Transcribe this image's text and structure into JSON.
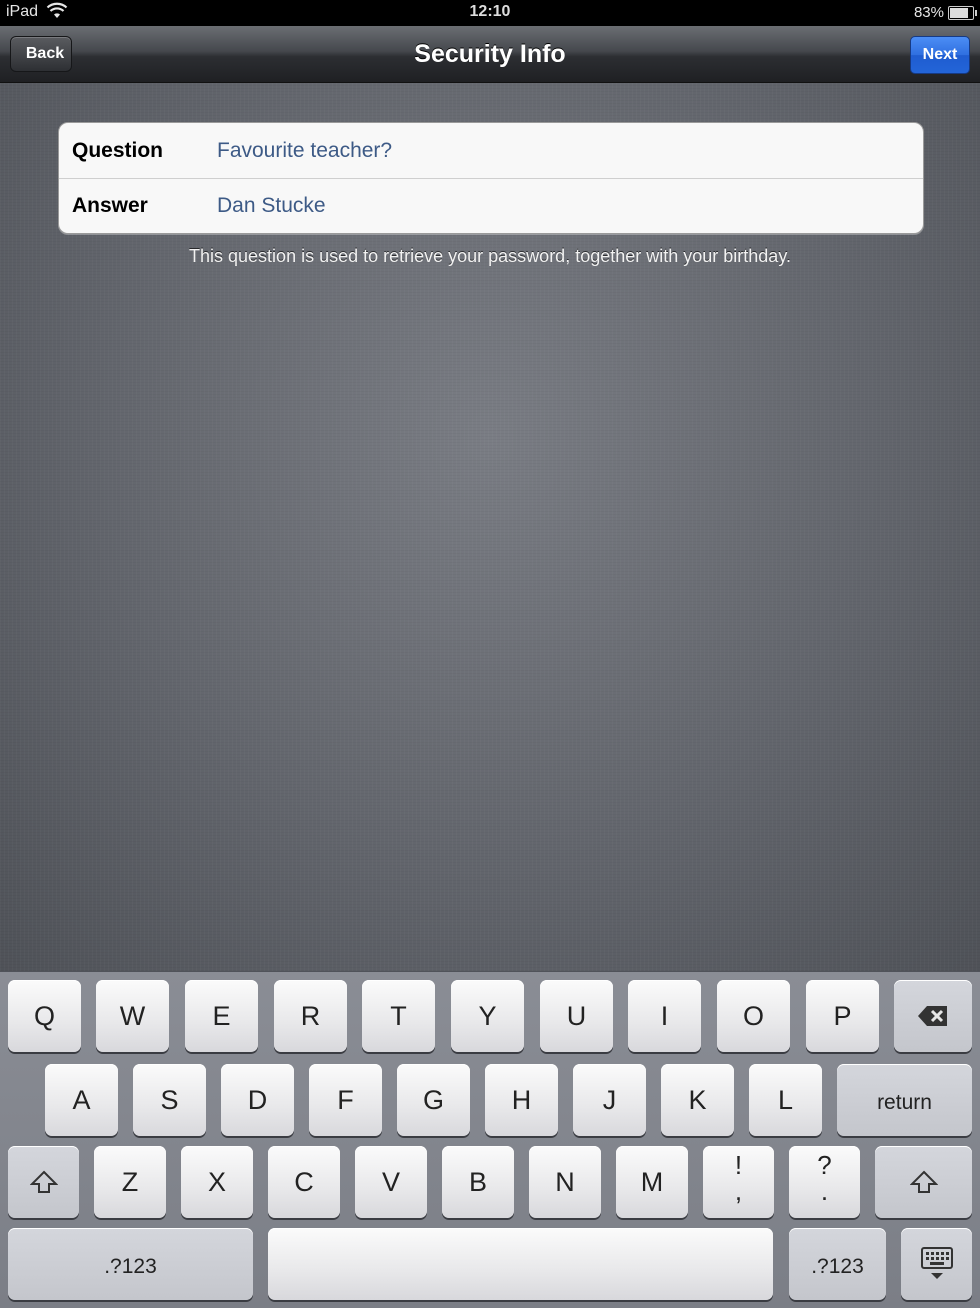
{
  "status_bar": {
    "carrier": "iPad",
    "time": "12:10",
    "battery": "83%",
    "battery_level": 0.83
  },
  "nav": {
    "title": "Security Info",
    "back_label": "Back",
    "next_label": "Next"
  },
  "form": {
    "question_label": "Question",
    "question_value": "Favourite teacher?",
    "answer_label": "Answer",
    "answer_value": "Dan Stucke",
    "hint": "This question is used to retrieve your password, together with your birthday."
  },
  "keyboard": {
    "row1": [
      "Q",
      "W",
      "E",
      "R",
      "T",
      "Y",
      "U",
      "I",
      "O",
      "P"
    ],
    "row2": [
      "A",
      "S",
      "D",
      "F",
      "G",
      "H",
      "J",
      "K",
      "L"
    ],
    "return_label": "return",
    "row3": [
      "Z",
      "X",
      "C",
      "V",
      "B",
      "N",
      "M"
    ],
    "punct1_top": "!",
    "punct1_bottom": ",",
    "punct2_top": "?",
    "punct2_bottom": ".",
    "numbers_label": ".?123"
  },
  "colors": {
    "next_button": "#2f6fe0",
    "field_value": "#3d5a86"
  }
}
